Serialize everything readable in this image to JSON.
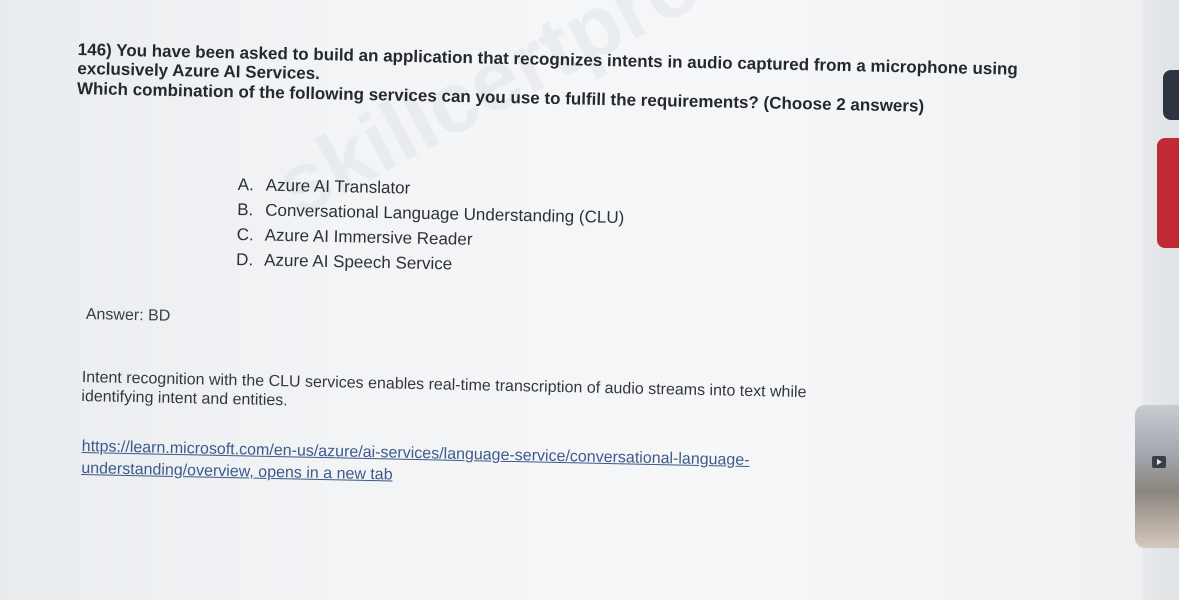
{
  "question": {
    "line1": "146) You have been asked to build an application that recognizes intents in audio captured from a microphone using",
    "line2": "exclusively Azure AI Services.",
    "line3": "Which combination of the following services can you use to fulfill the requirements? (Choose 2 answers)"
  },
  "options": [
    {
      "letter": "A.",
      "text": "Azure AI Translator"
    },
    {
      "letter": "B.",
      "text": "Conversational Language Understanding (CLU)"
    },
    {
      "letter": "C.",
      "text": "Azure AI Immersive Reader"
    },
    {
      "letter": "D.",
      "text": "Azure AI Speech Service"
    }
  ],
  "answer": "Answer: BD",
  "explanation": {
    "line1": "Intent recognition with the CLU services enables real-time transcription of audio streams into text while",
    "line2": "identifying intent and entities."
  },
  "reference_link": {
    "line1": "https://learn.microsoft.com/en-us/azure/ai-services/language-service/conversational-language-",
    "line2": "understanding/overview, opens in a new tab"
  },
  "watermark": "skillcertpro-exams-pixel.com",
  "colors": {
    "link": "#3d5a8a",
    "side_tab_red": "#c02a35",
    "side_tab_dark": "#2f3540"
  },
  "icons": {
    "thumbnail_play": "play-icon"
  }
}
